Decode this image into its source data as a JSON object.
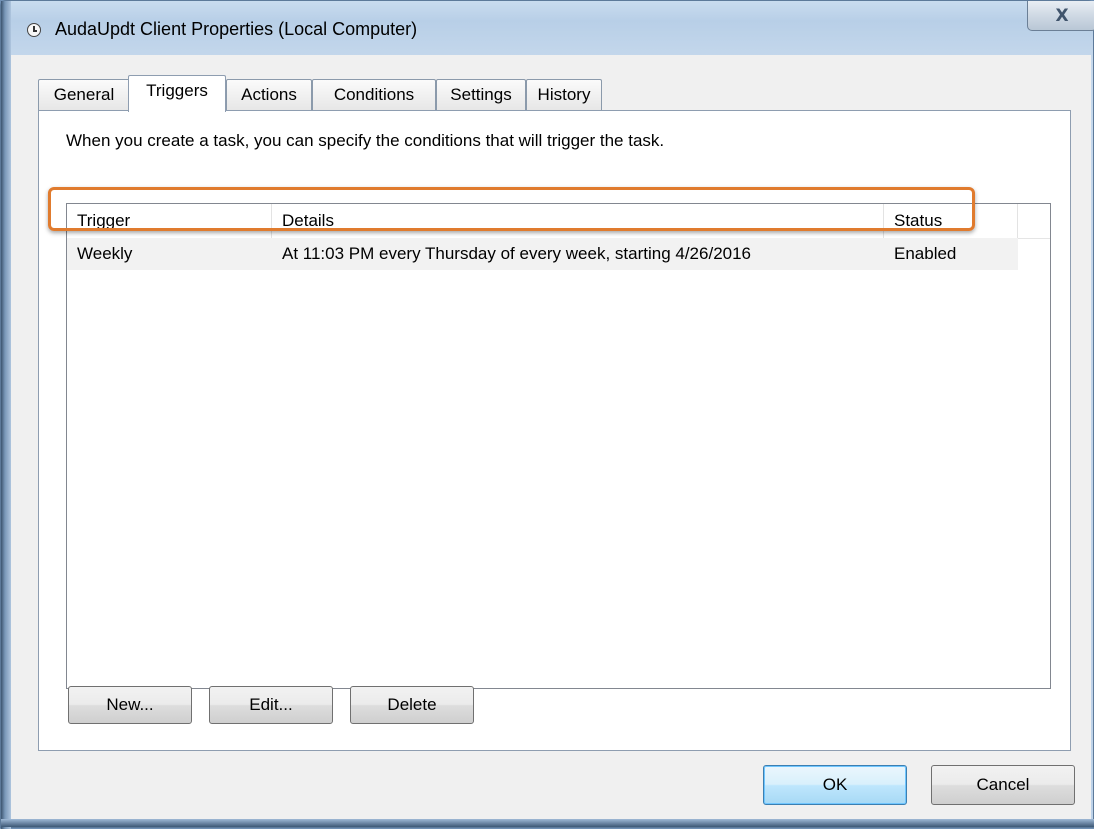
{
  "window": {
    "title": "AudaUpdt Client Properties (Local Computer)",
    "title_icon": "clock-icon",
    "close_label": "X"
  },
  "tabs": [
    {
      "label": "General",
      "active": false
    },
    {
      "label": "Triggers",
      "active": true
    },
    {
      "label": "Actions",
      "active": false
    },
    {
      "label": "Conditions",
      "active": false
    },
    {
      "label": "Settings",
      "active": false
    },
    {
      "label": "History",
      "active": false
    }
  ],
  "triggers_panel": {
    "description": "When you create a task, you can specify the conditions that will trigger the task.",
    "columns": [
      "Trigger",
      "Details",
      "Status"
    ],
    "rows": [
      {
        "trigger": "Weekly",
        "details": "At 11:03 PM every Thursday of every week, starting 4/26/2016",
        "status": "Enabled",
        "selected": true
      }
    ],
    "buttons": {
      "new": "New...",
      "edit": "Edit...",
      "delete": "Delete"
    }
  },
  "footer": {
    "ok": "OK",
    "cancel": "Cancel"
  },
  "colors": {
    "highlight_outline": "#e07b2e",
    "default_button_border": "#3c7fb1"
  }
}
